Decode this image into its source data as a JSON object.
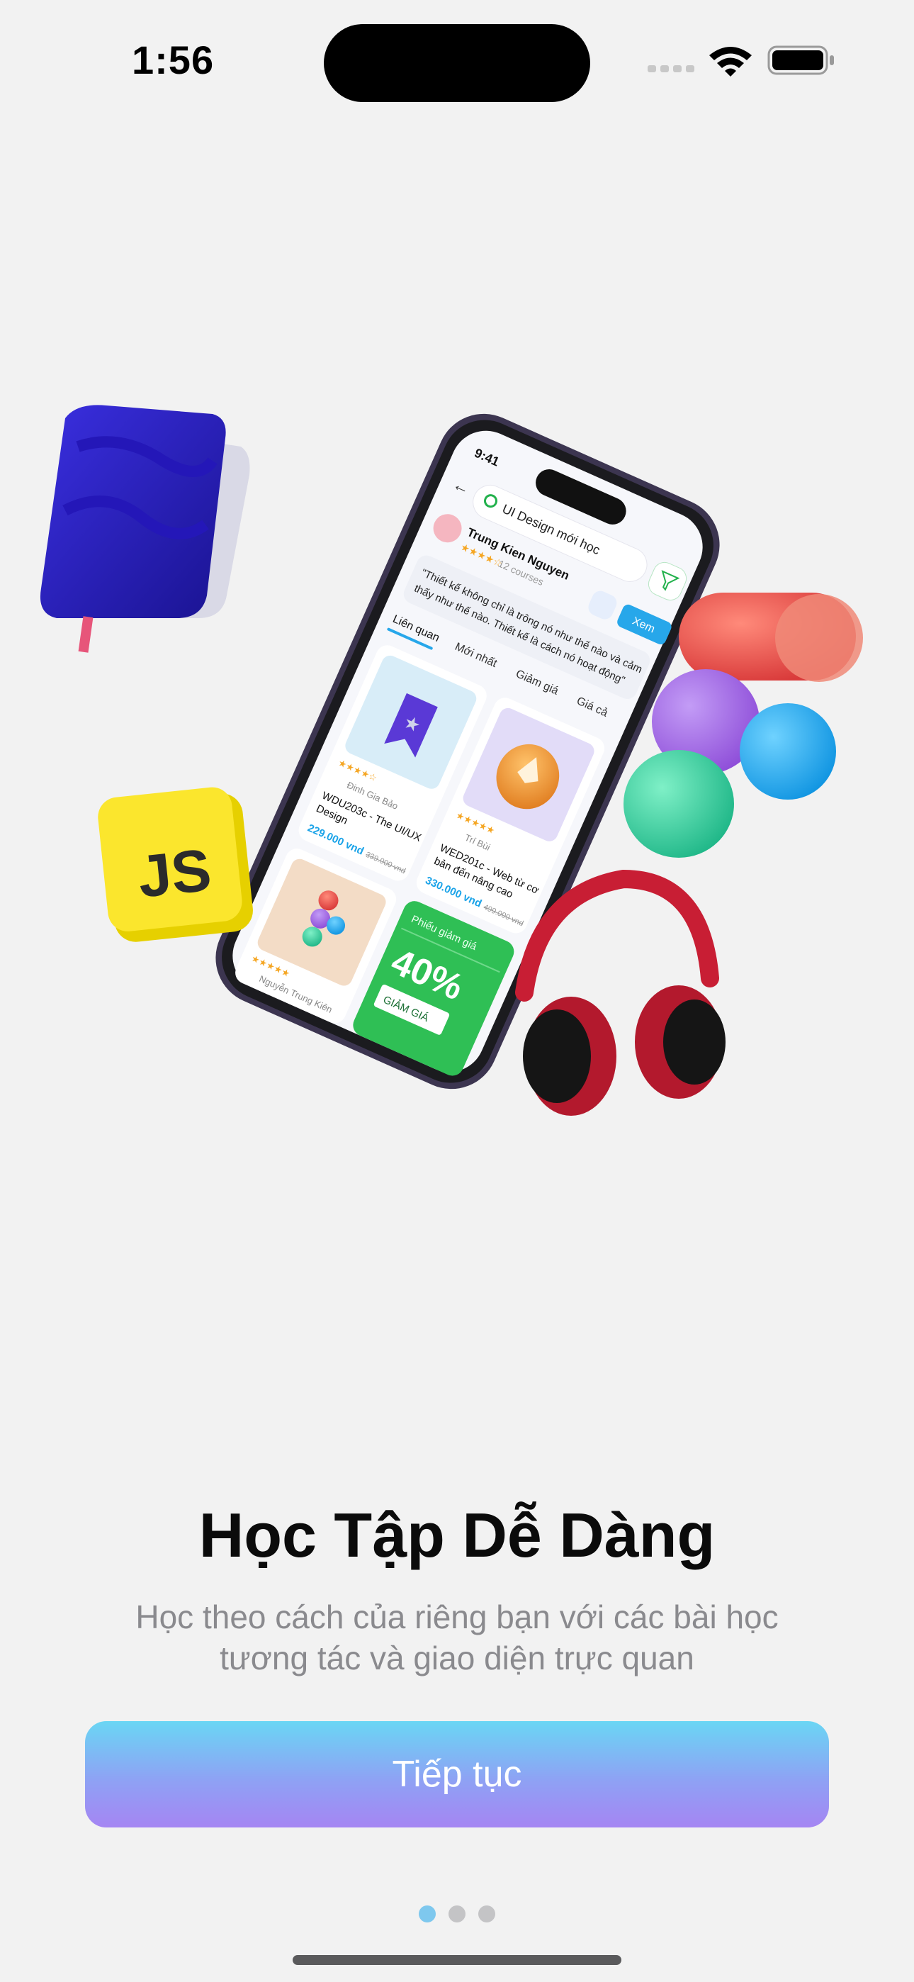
{
  "status_bar": {
    "time": "1:56"
  },
  "phone": {
    "time": "9:41",
    "search_text": "UI Design mới học",
    "author_name": "Trung Kien Nguyen",
    "author_courses": "12 courses",
    "view_button": "Xem",
    "quote_line1": "\"Thiết kế không chỉ là trông nó như thế nào và cảm",
    "quote_line2": "thấy như thế nào. Thiết kế là cách nó hoạt động\"",
    "tabs": [
      "Liên quan",
      "Mới nhất",
      "Giảm giá",
      "Giá cả"
    ],
    "card1": {
      "author": "Đinh Gia Bảo",
      "title1": "WDU203c - The UI/UX",
      "title2": "Design",
      "price": "229.000 vnd",
      "old_price": "339.000 vnd"
    },
    "card2": {
      "author": "Trí Bùi",
      "title1": "WED201c - Web từ cơ",
      "title2": "bản đến nâng cao",
      "price": "330.000 vnd",
      "old_price": "499.000 vnd"
    },
    "card3": {
      "author": "Nguyễn Trung Kiên"
    },
    "voucher": {
      "label": "Phiếu giảm giá",
      "percent": "40%",
      "tag": "GIẢM GIÁ"
    }
  },
  "js_badge": "JS",
  "onboarding": {
    "title": "Học Tập Dễ Dàng",
    "subtitle": "Học theo cách của riêng bạn với các bài học tương tác và giao diện trực quan",
    "continue_label": "Tiếp tục"
  },
  "colors": {
    "accent_gradient_top": "#6ad6f4",
    "accent_gradient_bottom": "#a585f3",
    "active_dot": "#7ec8ee",
    "price_blue": "#1aa3e8",
    "voucher_green": "#2fbf55"
  }
}
